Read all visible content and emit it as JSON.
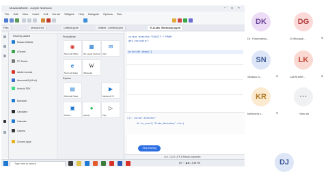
{
  "window": {
    "title": "Mosaic4Mobile - Jupyter Notebook",
    "controls": [
      "–",
      "□",
      "×"
    ]
  },
  "menu": [
    "File",
    "Edit",
    "View",
    "Insert",
    "Cell",
    "Kernel",
    "Widgets",
    "Help",
    "Navigate",
    "Options",
    "Run"
  ],
  "tabs": [
    {
      "label": "Files"
    },
    {
      "label": "Mosaic4 ext"
    },
    {
      "label": "Untitled.ipynb"
    },
    {
      "label": "Untitled - Untitled.ipynb"
    },
    {
      "label": "YL2Labs_Workshop.ipynb"
    }
  ],
  "code": {
    "lines": [
      "cursor.execute(\"SELECT * FROM",
      "    get_variable(\"",
      "print(df.head())"
    ]
  },
  "console": {
    "lines": [
      "[1]: cursor.execute(\"",
      "df.to_excel(\"2Labs_Workshop\".xlsx)"
    ]
  },
  "notification": {
    "label": "Stop sharing"
  },
  "statusbar": {
    "text": "Ln 1, Col 1   UTF-8   Ready   Automatic"
  },
  "start_menu": {
    "header": "Recently added",
    "left_items": [
      {
        "label": "Mosaic 4Mobile",
        "color": "#1f78d1"
      },
      {
        "label": "uTorrent",
        "color": "#3aa64a"
      },
      {
        "label": "PC Doctor",
        "color": "#777777"
      },
      {
        "label": "Adobe Acrobat",
        "color": "#d6322a"
      },
      {
        "label": "Anaconda3 (64-bit)",
        "color": "#3b6cc9"
      },
      {
        "label": "Android SDK",
        "color": "#3ddc84"
      },
      {
        "label": "Bluetooth",
        "color": "#1f78d1"
      },
      {
        "label": "Calculator",
        "color": "#2b2b2b"
      },
      {
        "label": "Calendar",
        "color": "#1f78d1"
      },
      {
        "label": "Camera",
        "color": "#3a3a3a"
      },
      {
        "label": "Chrome Apps",
        "color": "#e8b21f"
      }
    ],
    "right_sections": [
      {
        "label": "Productivity"
      },
      {
        "label": "Explore"
      }
    ],
    "tiles": [
      {
        "label": "Microsoft Office",
        "glyph": "◉",
        "color": "#d6322a"
      },
      {
        "label": "We speak Outlook",
        "glyph": "▦",
        "color": "#1f78d1"
      },
      {
        "label": "Mail",
        "glyph": "✉",
        "color": "#1f78d1"
      },
      {
        "label": "Microsoft Edge",
        "glyph": "e",
        "color": "#1f78d1"
      },
      {
        "label": "Wikipedia",
        "glyph": "W",
        "color": "#222222"
      },
      {
        "label": "Microsoft Store",
        "glyph": "▤",
        "color": "#1f78d1"
      },
      {
        "label": "",
        "glyph": "",
        "color": "#ffffff"
      },
      {
        "label": "Movies & TV",
        "glyph": "▶",
        "color": "#1f78d1"
      },
      {
        "label": "Photos",
        "glyph": "▣",
        "color": "#1f78d1"
      },
      {
        "label": "Spotify",
        "glyph": "●",
        "color": "#1db954"
      },
      {
        "label": "Play",
        "glyph": "▷",
        "color": "#333333"
      }
    ]
  },
  "taskbar": {
    "search_placeholder": "Type here to search",
    "tray": "EN  ⌃  ◀  ■  ♪  4:58 PM"
  },
  "participants": [
    {
      "initials": "DK",
      "name": "Dr. Thirumalesu...",
      "bg": "#ecdcf6",
      "fg": "#6a4598"
    },
    {
      "initials": "DG",
      "name": "Dr Bhoopal...",
      "bg": "#fbd9d9",
      "fg": "#b23a3a"
    },
    {
      "initials": "SN",
      "name": "Silnikka N...",
      "bg": "#dde6f6",
      "fg": "#3d5a96"
    },
    {
      "initials": "LK",
      "name": "LAKSHMIP...",
      "bg": "#fbd9d3",
      "fg": "#c24a38"
    },
    {
      "initials": "KR",
      "name": "kollimarla s...",
      "bg": "#fbead0",
      "fg": "#b07a28"
    },
    {
      "initials": "···",
      "name": "View all",
      "bg": "#f0f1f3",
      "fg": "#999999"
    },
    {
      "initials": "DJ",
      "name": "",
      "bg": "#dde6f6",
      "fg": "#3d5a96"
    }
  ]
}
